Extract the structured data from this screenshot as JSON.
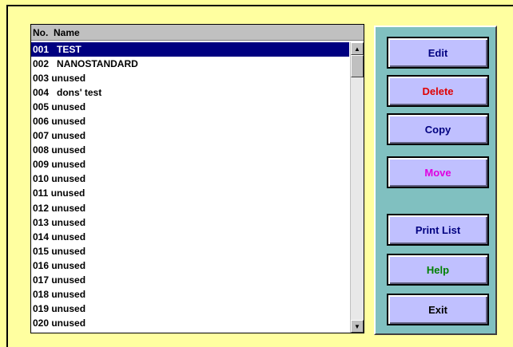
{
  "list": {
    "headers": {
      "no": "No.",
      "name": "Name"
    },
    "rows": [
      {
        "text": "001   TEST"
      },
      {
        "text": "002   NANOSTANDARD"
      },
      {
        "text": "003 unused"
      },
      {
        "text": "004   dons' test"
      },
      {
        "text": "005 unused"
      },
      {
        "text": "006 unused"
      },
      {
        "text": "007 unused"
      },
      {
        "text": "008 unused"
      },
      {
        "text": "009 unused"
      },
      {
        "text": "010 unused"
      },
      {
        "text": "011 unused"
      },
      {
        "text": "012 unused"
      },
      {
        "text": "013 unused"
      },
      {
        "text": "014 unused"
      },
      {
        "text": "015 unused"
      },
      {
        "text": "016 unused"
      },
      {
        "text": "017 unused"
      },
      {
        "text": "018 unused"
      },
      {
        "text": "019 unused"
      },
      {
        "text": "020 unused"
      }
    ],
    "selected_index": 0
  },
  "buttons": {
    "edit": {
      "pre": "",
      "accel": "E",
      "post": "dit",
      "color": "#000080"
    },
    "delete": {
      "pre": "",
      "accel": "D",
      "post": "elete",
      "color": "#e00000"
    },
    "copy": {
      "pre": "",
      "accel": "C",
      "post": "opy",
      "color": "#000080"
    },
    "move": {
      "pre": "",
      "accel": "M",
      "post": "ove",
      "color": "#e000e0"
    },
    "print_list": {
      "pre": "",
      "accel": "P",
      "post": "rint List",
      "color": "#000080"
    },
    "help": {
      "pre": "",
      "accel": "H",
      "post": "elp",
      "color": "#008000"
    },
    "exit": {
      "pre": "E",
      "accel": "x",
      "post": "it",
      "color": "#000000"
    }
  },
  "colors": {
    "background": "#ffff99",
    "selection": "#000080",
    "panel": "#80c0c0",
    "button": "#c0c0ff"
  },
  "icons": {
    "scroll_up": "triangle-up",
    "scroll_down": "triangle-down"
  }
}
